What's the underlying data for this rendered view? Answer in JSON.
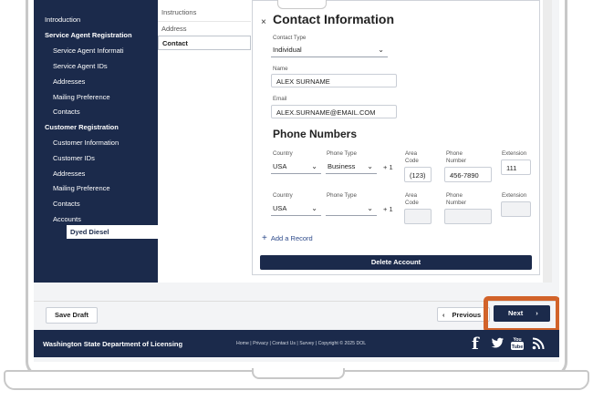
{
  "sidebar": {
    "items": [
      {
        "label": "Introduction"
      },
      {
        "label": "Service Agent Registration"
      },
      {
        "label": "Service Agent Informati"
      },
      {
        "label": "Service Agent IDs"
      },
      {
        "label": "Addresses"
      },
      {
        "label": "Mailing Preference"
      },
      {
        "label": "Contacts"
      },
      {
        "label": "Customer Registration"
      },
      {
        "label": "Customer Information"
      },
      {
        "label": "Customer IDs"
      },
      {
        "label": "Addresses"
      },
      {
        "label": "Mailing Preference"
      },
      {
        "label": "Contacts"
      },
      {
        "label": "Accounts"
      },
      {
        "label": "Dyed Diesel"
      }
    ]
  },
  "subnav": {
    "items": [
      {
        "label": "Instructions"
      },
      {
        "label": "Address"
      },
      {
        "label": "Contact"
      }
    ]
  },
  "contact": {
    "close_symbol": "×",
    "title": "Contact Information",
    "contact_type_label": "Contact Type",
    "contact_type_value": "Individual",
    "name_label": "Name",
    "name_value": "ALEX SURNAME",
    "email_label": "Email",
    "email_value": "ALEX.SURNAME@EMAIL.COM"
  },
  "phones": {
    "title": "Phone Numbers",
    "col_country": "Country",
    "col_type": "Phone Type",
    "col_area": "Area Code",
    "col_number": "Phone Number",
    "col_ext": "Extension",
    "plus_one": "+ 1",
    "rows": [
      {
        "country": "USA",
        "type": "Business",
        "area": "(123)",
        "number": "456-7890",
        "ext": "111"
      },
      {
        "country": "USA",
        "type": "",
        "area": "",
        "number": "",
        "ext": ""
      }
    ],
    "add_record": "Add a Record"
  },
  "delete_account": "Delete Account",
  "nav": {
    "save_draft": "Save Draft",
    "previous": "Previous",
    "prev_chevron": "‹",
    "next": "Next",
    "next_chevron": "›",
    "highlight_color": "#d2632a"
  },
  "footer": {
    "title": "Washington State Department of Licensing",
    "links": "Home | Privacy | Contact Us | Survey | Copyright © 2025 DOL",
    "social_icons": [
      "facebook-icon",
      "twitter-icon",
      "youtube-icon",
      "rss-icon"
    ]
  },
  "colors": {
    "navy": "#1b2a4b",
    "link": "#2d4a8a"
  }
}
